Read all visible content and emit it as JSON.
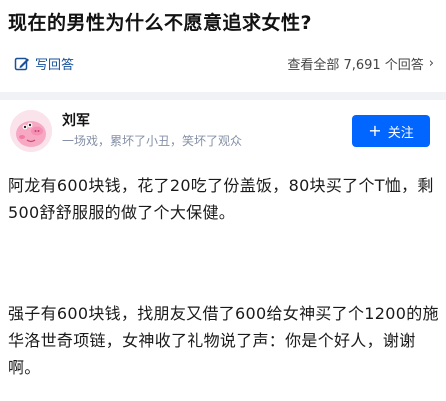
{
  "question": {
    "title": "现在的男性为什么不愿意追求女性?",
    "write_answer_label": "写回答",
    "view_all_label": "查看全部 7,691 个回答",
    "answer_count": 7691
  },
  "author": {
    "name": "刘军",
    "bio": "一场戏，累坏了小丑，笑坏了观众",
    "follow_label": "关注"
  },
  "answer": {
    "paragraphs": [
      "阿龙有600块钱，花了20吃了份盖饭，80块买了个T恤，剩500舒舒服服的做了个大保健。",
      "强子有600块钱，找朋友又借了600给女神买了个1200的施华洛世奇项链，女神收了礼物说了声：你是个好人，谢谢啊。"
    ]
  },
  "colors": {
    "accent": "#0066ff",
    "link": "#175199",
    "muted": "#8590a6",
    "divider": "#f0f2f5"
  },
  "icons": {
    "write": "edit-icon",
    "chevron": "chevron-right-icon",
    "plus": "plus-icon"
  }
}
